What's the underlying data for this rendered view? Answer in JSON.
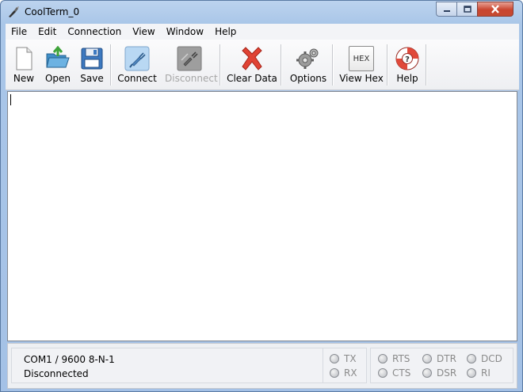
{
  "window": {
    "title": "CoolTerm_0"
  },
  "menu": [
    "File",
    "Edit",
    "Connection",
    "View",
    "Window",
    "Help"
  ],
  "toolbar": {
    "new": "New",
    "open": "Open",
    "save": "Save",
    "connect": "Connect",
    "disconnect": "Disconnect",
    "clear_data": "Clear Data",
    "options": "Options",
    "view_hex": "View Hex",
    "help": "Help",
    "hex_icon_text": "HEX"
  },
  "status": {
    "port_settings": "COM1 / 9600 8-N-1",
    "connection_state": "Disconnected"
  },
  "indicators": {
    "tx": "TX",
    "rx": "RX",
    "rts": "RTS",
    "cts": "CTS",
    "dtr": "DTR",
    "dsr": "DSR",
    "dcd": "DCD",
    "ri": "RI"
  },
  "icons": {
    "app": "coolterm-app-icon",
    "new": "new-document-icon",
    "open": "open-folder-icon",
    "save": "floppy-disk-icon",
    "connect": "connector-plug-icon",
    "disconnect": "disconnect-plug-icon",
    "clear": "red-x-icon",
    "options": "gears-icon",
    "help": "lifebuoy-icon"
  }
}
